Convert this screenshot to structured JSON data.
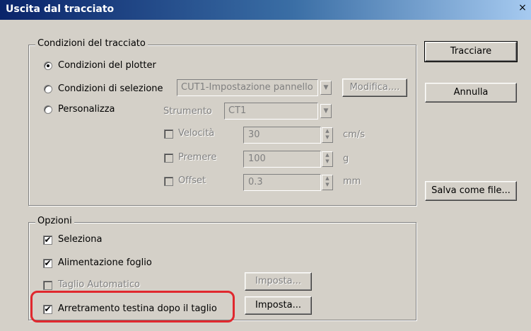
{
  "window": {
    "title": "Uscita dal tracciato",
    "close_glyph": "×"
  },
  "buttons": {
    "plot": "Tracciare",
    "cancel": "Annulla",
    "save_file": "Salva come file..."
  },
  "plot_conditions": {
    "legend": "Condizioni del tracciato",
    "radio_plotter": "Condizioni del plotter",
    "radio_selection": "Condizioni di selezione",
    "radio_custom": "Personalizza",
    "selection_value": "CUT1-Impostazione pannello",
    "modify_button": "Modifica....",
    "tool_label": "Strumento",
    "tool_value": "CT1",
    "speed": {
      "label": "Velocità",
      "value": "30",
      "unit": "cm/s"
    },
    "pressure": {
      "label": "Premere",
      "value": "100",
      "unit": "g"
    },
    "offset": {
      "label": "Offset",
      "value": "0.3",
      "unit": "mm"
    }
  },
  "options": {
    "legend": "Opzioni",
    "select": "Seleziona",
    "sheet_feed": "Alimentazione foglio",
    "auto_cut": "Taglio Automatico",
    "auto_cut_setup": "Imposta...",
    "head_retract": "Arretramento testina dopo il taglio",
    "head_retract_setup": "Imposta..."
  },
  "checkmark_glyph": "✔",
  "highlight_color": "#e0282e"
}
